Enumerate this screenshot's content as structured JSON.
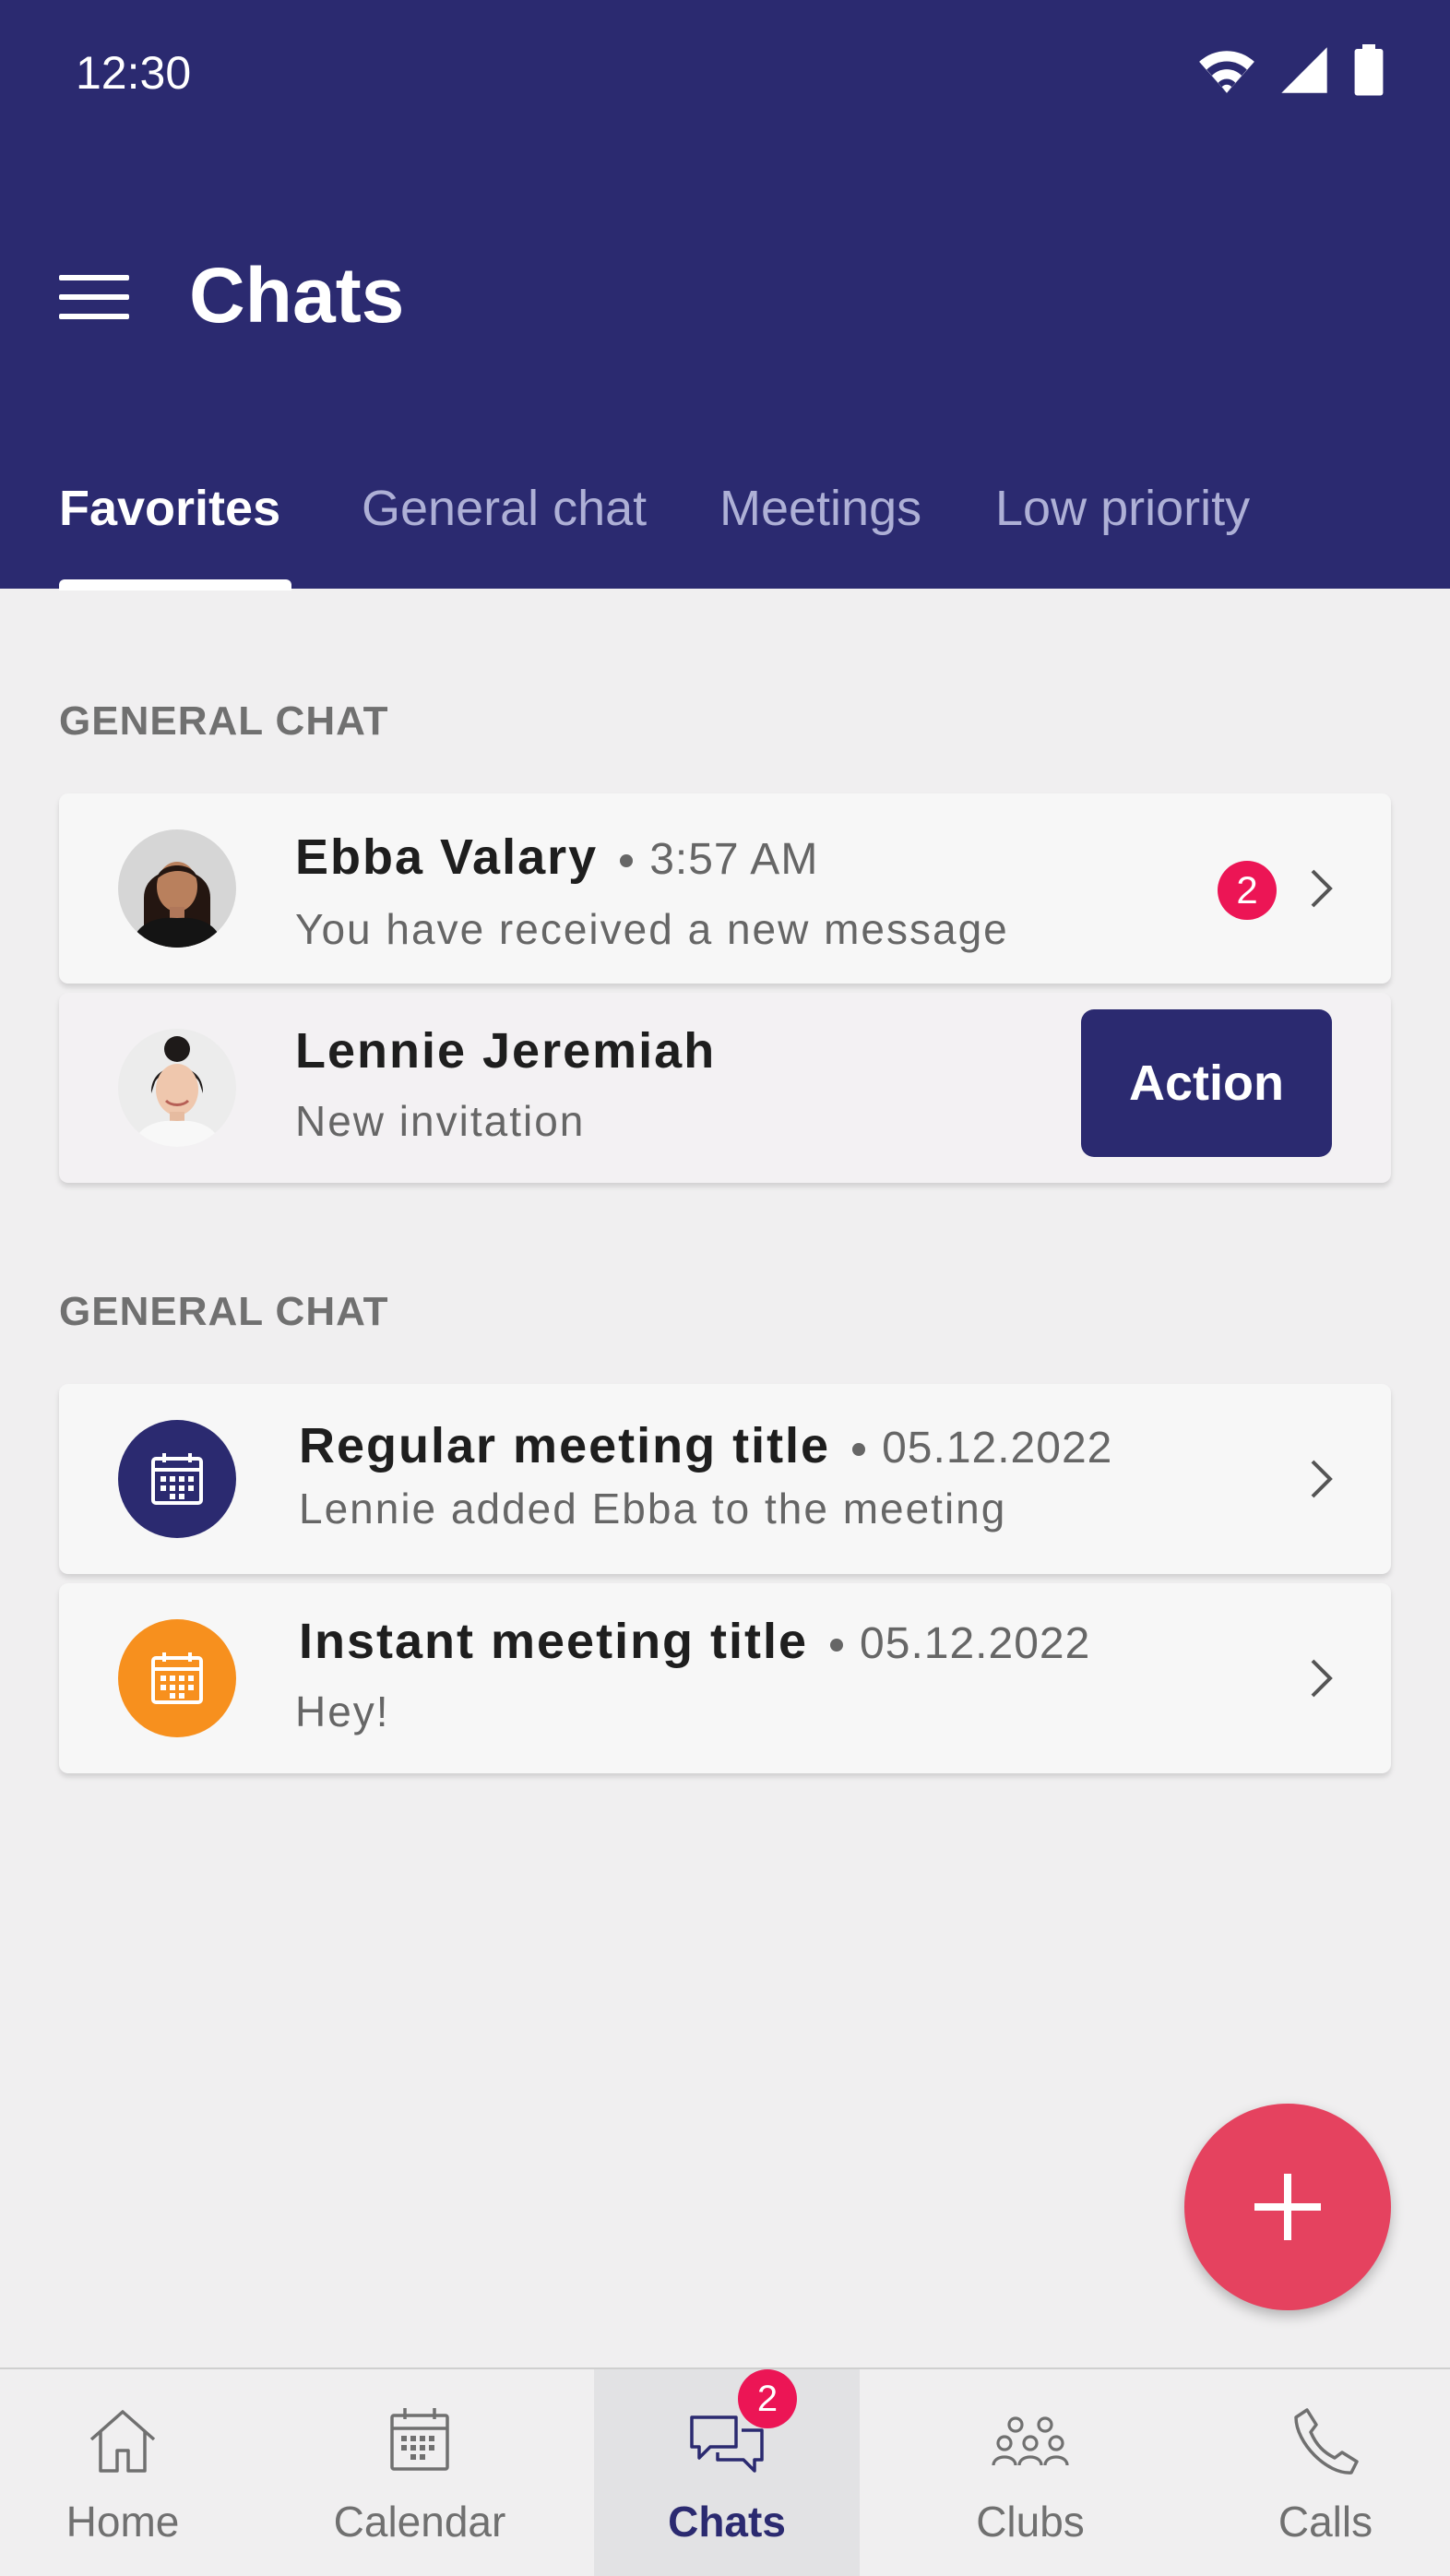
{
  "status_bar": {
    "time": "12:30"
  },
  "header": {
    "title": "Chats"
  },
  "tabs": [
    {
      "label": "Favorites",
      "active": true
    },
    {
      "label": "General chat",
      "active": false
    },
    {
      "label": "Meetings",
      "active": false
    },
    {
      "label": "Low priority",
      "active": false
    }
  ],
  "sections": [
    {
      "label": "GENERAL CHAT",
      "items": [
        {
          "name": "Ebba Valary",
          "time": "3:57 AM",
          "subtitle": "You have received a new message",
          "badge": "2",
          "avatar": "photo-avatar"
        },
        {
          "name": "Lennie Jeremiah",
          "subtitle": "New invitation",
          "action_label": "Action",
          "avatar": "photo-avatar"
        }
      ]
    },
    {
      "label": "GENERAL CHAT",
      "items": [
        {
          "name": "Regular meeting title",
          "time": "05.12.2022",
          "subtitle": "Lennie added Ebba to the meeting",
          "avatar": "calendar-icon",
          "avatar_color": "#2b2a70"
        },
        {
          "name": "Instant meeting title",
          "time": "05.12.2022",
          "subtitle": "Hey!",
          "avatar": "calendar-icon",
          "avatar_color": "#f7901e"
        }
      ]
    }
  ],
  "fab": {
    "icon": "plus-icon",
    "color": "#e5425f"
  },
  "bottom_nav": [
    {
      "label": "Home",
      "icon": "home-icon",
      "active": false
    },
    {
      "label": "Calendar",
      "icon": "calendar-icon",
      "active": false
    },
    {
      "label": "Chats",
      "icon": "chat-icon",
      "active": true,
      "badge": "2"
    },
    {
      "label": "Clubs",
      "icon": "clubs-icon",
      "active": false
    },
    {
      "label": "Calls",
      "icon": "phone-icon",
      "active": false
    }
  ],
  "colors": {
    "primary": "#2b2a70",
    "badge": "#ec1555",
    "background": "#f0eff0"
  }
}
